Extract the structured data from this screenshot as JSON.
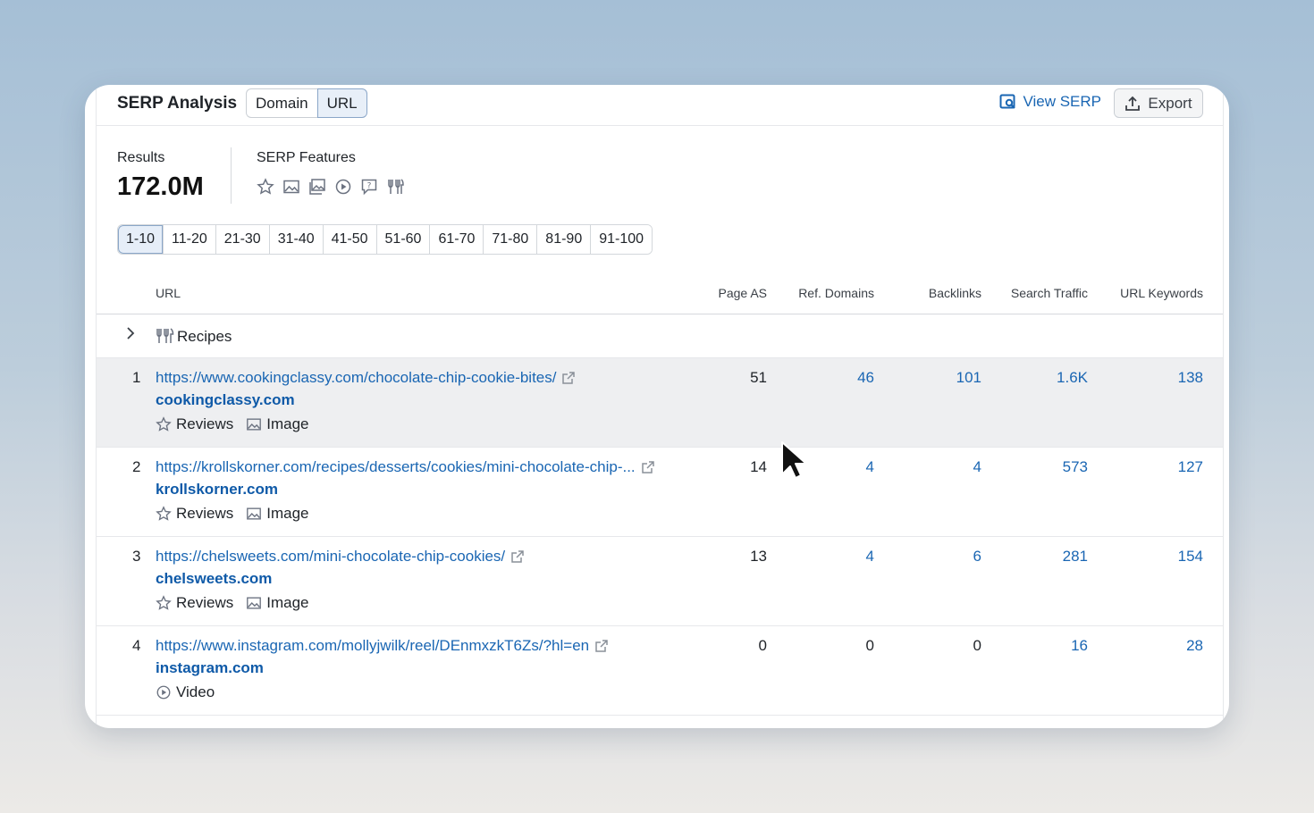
{
  "header": {
    "title": "SERP Analysis",
    "toggle": [
      "Domain",
      "URL"
    ],
    "active_toggle": "URL",
    "view_serp_label": "View SERP",
    "export_label": "Export"
  },
  "summary": {
    "results_label": "Results",
    "results_value": "172.0M",
    "serp_features_label": "SERP Features",
    "serp_feature_icons": [
      "star-icon",
      "image-icon",
      "image-pack-icon",
      "video-icon",
      "faq-icon",
      "recipes-icon"
    ]
  },
  "pagination": {
    "pages": [
      "1-10",
      "11-20",
      "21-30",
      "31-40",
      "41-50",
      "51-60",
      "61-70",
      "71-80",
      "81-90",
      "91-100"
    ],
    "active": "1-10"
  },
  "table": {
    "columns": {
      "url": "URL",
      "page_as": "Page AS",
      "ref_domains": "Ref. Domains",
      "backlinks": "Backlinks",
      "search_traffic": "Search Traffic",
      "url_keywords": "URL Keywords"
    },
    "group": {
      "label": "Recipes"
    },
    "rows": [
      {
        "num": "1",
        "url": "https://www.cookingclassy.com/chocolate-chip-cookie-bites/",
        "domain": "cookingclassy.com",
        "features": [
          "Reviews",
          "Image"
        ],
        "page_as": "51",
        "ref_domains": "46",
        "backlinks": "101",
        "search_traffic": "1.6K",
        "url_keywords": "138"
      },
      {
        "num": "2",
        "url": "https://krollskorner.com/recipes/desserts/cookies/mini-chocolate-chip-...",
        "domain": "krollskorner.com",
        "features": [
          "Reviews",
          "Image"
        ],
        "page_as": "14",
        "ref_domains": "4",
        "backlinks": "4",
        "search_traffic": "573",
        "url_keywords": "127"
      },
      {
        "num": "3",
        "url": "https://chelsweets.com/mini-chocolate-chip-cookies/",
        "domain": "chelsweets.com",
        "features": [
          "Reviews",
          "Image"
        ],
        "page_as": "13",
        "ref_domains": "4",
        "backlinks": "6",
        "search_traffic": "281",
        "url_keywords": "154"
      },
      {
        "num": "4",
        "url": "https://www.instagram.com/mollyjwilk/reel/DEnmxzkT6Zs/?hl=en",
        "domain": "instagram.com",
        "features": [
          "Video"
        ],
        "page_as": "0",
        "ref_domains": "0",
        "backlinks": "0",
        "search_traffic": "16",
        "url_keywords": "28"
      }
    ]
  },
  "colors": {
    "link": "#1a66b3",
    "domain": "#0f5aa8",
    "hover_row": "#eeeff1",
    "active_tab_bg": "#e8eff8"
  }
}
